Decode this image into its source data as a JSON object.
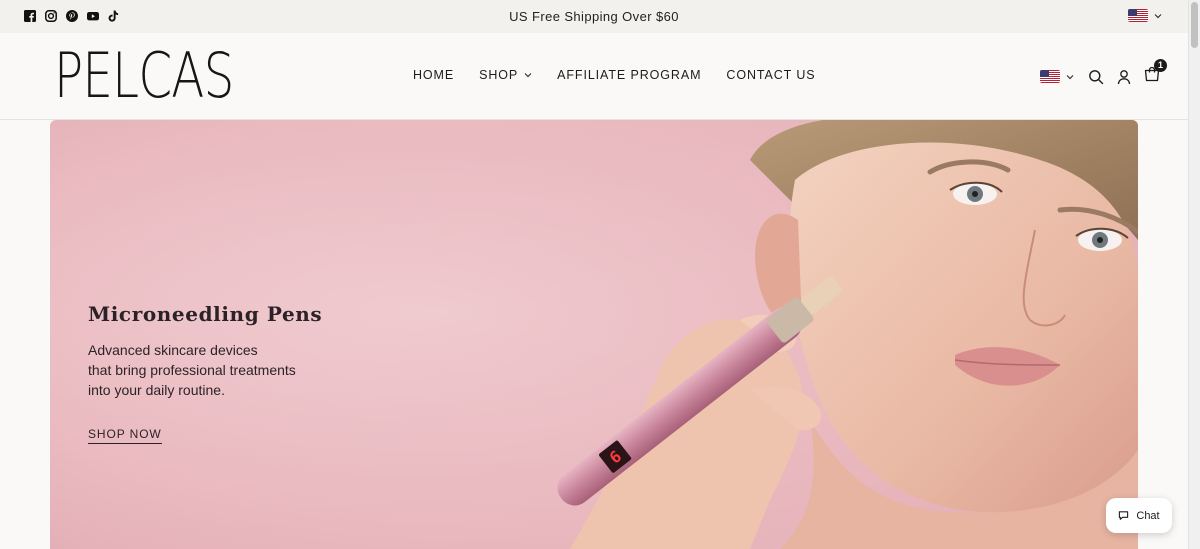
{
  "announcement": {
    "text": "US Free Shipping Over $60",
    "socials": [
      "facebook-icon",
      "instagram-icon",
      "pinterest-icon",
      "youtube-icon",
      "tiktok-icon"
    ],
    "country": "United States"
  },
  "header": {
    "logo": "PELCAS",
    "nav": [
      {
        "label": "HOME",
        "dropdown": false
      },
      {
        "label": "SHOP",
        "dropdown": true
      },
      {
        "label": "AFFILIATE PROGRAM",
        "dropdown": false
      },
      {
        "label": "CONTACT US",
        "dropdown": false
      }
    ],
    "cart_count": "1"
  },
  "hero": {
    "title": "Microneedling Pens",
    "subtitle_lines": [
      "Advanced skincare devices",
      "that bring professional treatments",
      "into your daily routine."
    ],
    "cta": "SHOP NOW",
    "device_display": "6"
  },
  "chat": {
    "label": "Chat"
  },
  "colors": {
    "hero_pink": "#e9b9bf",
    "text_dark": "#1b1b1b",
    "background": "#faf9f7"
  }
}
